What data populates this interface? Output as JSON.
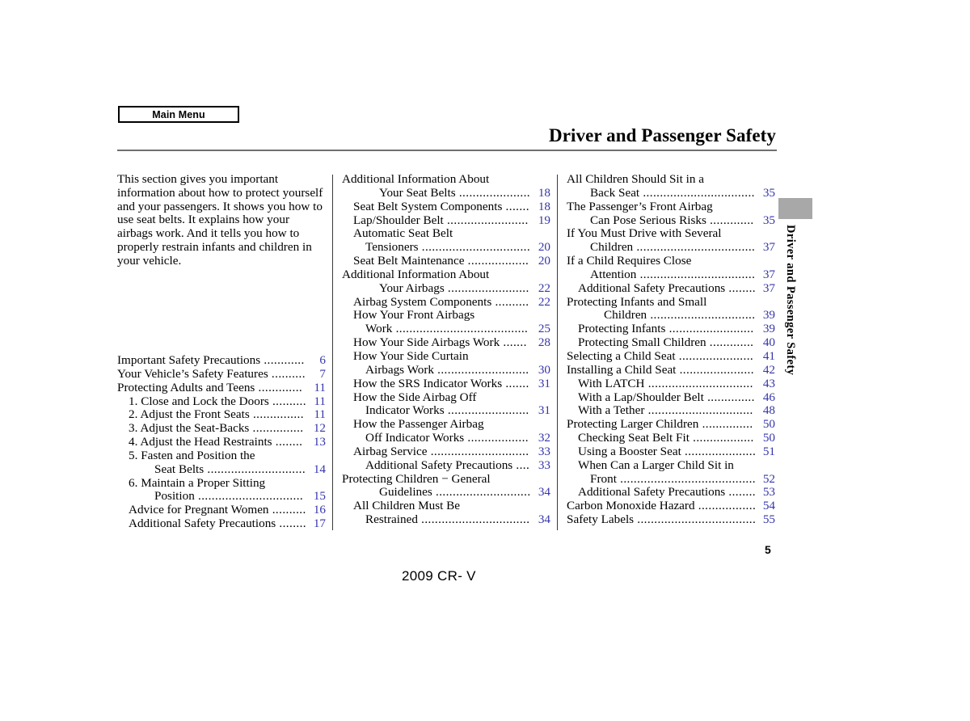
{
  "header": {
    "main_menu_label": "Main Menu",
    "chapter_title": "Driver and Passenger Safety"
  },
  "intro": {
    "text": "This section gives you important information about how to protect yourself and your passengers. It shows you how to use seat belts. It explains how your airbags work. And it tells you how to properly restrain infants and children in your vehicle."
  },
  "side_tab": {
    "label": "Driver and Passenger Safety"
  },
  "footer": {
    "page_number": "5",
    "model": "2009  CR- V"
  },
  "columns": [
    {
      "id": "column-1",
      "entries": [
        {
          "label": "Important Safety Precautions",
          "page": "6",
          "indent": 0,
          "leader": "dots"
        },
        {
          "label": "Your Vehicle’s Safety Features",
          "page": "7",
          "indent": 0,
          "leader": "dots"
        },
        {
          "label": "Protecting Adults and Teens",
          "page": "11",
          "indent": 0,
          "leader": "dots"
        },
        {
          "label": "1. Close and Lock the Doors",
          "page": "11",
          "indent": 1,
          "leader": "dots"
        },
        {
          "label": "2. Adjust the Front Seats",
          "page": "11",
          "indent": 1,
          "leader": "dots"
        },
        {
          "label": "3. Adjust the Seat-Backs",
          "page": "12",
          "indent": 1,
          "leader": "dots"
        },
        {
          "label": "4. Adjust the Head Restraints",
          "page": "13",
          "indent": 1,
          "leader": "dots"
        },
        {
          "label": "5. Fasten and Position the",
          "page": "",
          "indent": 1,
          "leader": "none"
        },
        {
          "label": "Seat Belts",
          "page": "14",
          "indent": 3,
          "leader": "dots"
        },
        {
          "label": "6. Maintain a Proper Sitting",
          "page": "",
          "indent": 1,
          "leader": "none"
        },
        {
          "label": "Position",
          "page": "15",
          "indent": 3,
          "leader": "dots"
        },
        {
          "label": "Advice for Pregnant Women",
          "page": "16",
          "indent": 1,
          "leader": "dots"
        },
        {
          "label": "Additional Safety Precautions",
          "page": "17",
          "indent": 1,
          "leader": "dots"
        }
      ]
    },
    {
      "id": "column-2",
      "entries": [
        {
          "label": "Additional Information About",
          "page": "",
          "indent": 0,
          "leader": "none"
        },
        {
          "label": "Your Seat Belts",
          "page": "18",
          "indent": 3,
          "leader": "dots"
        },
        {
          "label": "Seat Belt System Components",
          "page": "18",
          "indent": 1,
          "leader": "dots"
        },
        {
          "label": "Lap/Shoulder Belt",
          "page": "19",
          "indent": 1,
          "leader": "dots"
        },
        {
          "label": "Automatic Seat Belt",
          "page": "",
          "indent": 1,
          "leader": "none"
        },
        {
          "label": "Tensioners",
          "page": "20",
          "indent": 2,
          "leader": "dots"
        },
        {
          "label": "Seat Belt Maintenance",
          "page": "20",
          "indent": 1,
          "leader": "dots"
        },
        {
          "label": "Additional Information About",
          "page": "",
          "indent": 0,
          "leader": "none"
        },
        {
          "label": "Your Airbags",
          "page": "22",
          "indent": 3,
          "leader": "dots"
        },
        {
          "label": "Airbag System Components",
          "page": "22",
          "indent": 1,
          "leader": "dots"
        },
        {
          "label": "How Your Front Airbags",
          "page": "",
          "indent": 1,
          "leader": "none"
        },
        {
          "label": "Work",
          "page": "25",
          "indent": 2,
          "leader": "dots"
        },
        {
          "label": "How Your Side Airbags Work",
          "page": "28",
          "indent": 1,
          "leader": "dots"
        },
        {
          "label": "How Your Side Curtain",
          "page": "",
          "indent": 1,
          "leader": "none"
        },
        {
          "label": "Airbags Work",
          "page": "30",
          "indent": 2,
          "leader": "dots"
        },
        {
          "label": "How the SRS Indicator Works",
          "page": "31",
          "indent": 1,
          "leader": "dots"
        },
        {
          "label": "How the Side Airbag Off",
          "page": "",
          "indent": 1,
          "leader": "none"
        },
        {
          "label": "Indicator Works",
          "page": "31",
          "indent": 2,
          "leader": "dots"
        },
        {
          "label": "How the Passenger Airbag",
          "page": "",
          "indent": 1,
          "leader": "none"
        },
        {
          "label": "Off Indicator Works",
          "page": "32",
          "indent": 2,
          "leader": "dots"
        },
        {
          "label": "Airbag Service",
          "page": "33",
          "indent": 1,
          "leader": "dots"
        },
        {
          "label": "Additional Safety Precautions",
          "page": "33",
          "indent": 2,
          "leader": "dots"
        },
        {
          "label": "Protecting Children − General",
          "page": "",
          "indent": 0,
          "leader": "none"
        },
        {
          "label": "Guidelines",
          "page": "34",
          "indent": 3,
          "leader": "dots"
        },
        {
          "label": "All Children Must Be",
          "page": "",
          "indent": 1,
          "leader": "none"
        },
        {
          "label": "Restrained",
          "page": "34",
          "indent": 2,
          "leader": "dots"
        }
      ]
    },
    {
      "id": "column-3",
      "entries": [
        {
          "label": "All Children Should Sit in a",
          "page": "",
          "indent": 0,
          "leader": "none"
        },
        {
          "label": "Back Seat",
          "page": "35",
          "indent": 2,
          "leader": "dots"
        },
        {
          "label": "The Passenger’s Front Airbag",
          "page": "",
          "indent": 0,
          "leader": "none"
        },
        {
          "label": "Can Pose Serious Risks",
          "page": "35",
          "indent": 2,
          "leader": "dots"
        },
        {
          "label": "If You Must Drive with Several",
          "page": "",
          "indent": 0,
          "leader": "none"
        },
        {
          "label": "Children",
          "page": "37",
          "indent": 2,
          "leader": "dots"
        },
        {
          "label": "If a Child Requires Close",
          "page": "",
          "indent": 0,
          "leader": "none"
        },
        {
          "label": "Attention",
          "page": "37",
          "indent": 2,
          "leader": "dots"
        },
        {
          "label": "Additional Safety Precautions",
          "page": "37",
          "indent": 1,
          "leader": "dots"
        },
        {
          "label": "Protecting Infants and Small",
          "page": "",
          "indent": 0,
          "leader": "none"
        },
        {
          "label": "Children",
          "page": "39",
          "indent": 3,
          "leader": "dots"
        },
        {
          "label": "Protecting Infants",
          "page": "39",
          "indent": 1,
          "leader": "dots"
        },
        {
          "label": "Protecting Small Children",
          "page": "40",
          "indent": 1,
          "leader": "dots"
        },
        {
          "label": "Selecting a Child Seat",
          "page": "41",
          "indent": 0,
          "leader": "dots"
        },
        {
          "label": "Installing a Child Seat",
          "page": "42",
          "indent": 0,
          "leader": "dots"
        },
        {
          "label": "With LATCH",
          "page": "43",
          "indent": 1,
          "leader": "dots"
        },
        {
          "label": "With a Lap/Shoulder Belt",
          "page": "46",
          "indent": 1,
          "leader": "dots"
        },
        {
          "label": "With a Tether",
          "page": "48",
          "indent": 1,
          "leader": "dots"
        },
        {
          "label": "Protecting Larger Children",
          "page": "50",
          "indent": 0,
          "leader": "dots"
        },
        {
          "label": "Checking Seat Belt Fit",
          "page": "50",
          "indent": 1,
          "leader": "dots"
        },
        {
          "label": "Using a Booster Seat",
          "page": "51",
          "indent": 1,
          "leader": "dots"
        },
        {
          "label": "When Can a Larger Child Sit in",
          "page": "",
          "indent": 1,
          "leader": "none"
        },
        {
          "label": "Front",
          "page": "52",
          "indent": 2,
          "leader": "dots"
        },
        {
          "label": "Additional Safety Precautions",
          "page": "53",
          "indent": 1,
          "leader": "dots"
        },
        {
          "label": "Carbon Monoxide Hazard",
          "page": "54",
          "indent": 0,
          "leader": "dots"
        },
        {
          "label": "Safety Labels",
          "page": "55",
          "indent": 0,
          "leader": "dots"
        }
      ]
    }
  ],
  "colors": {
    "page_number_link": "#3535ab",
    "rule": "#6f6f6f",
    "tab_block": "#a8a8a8"
  }
}
